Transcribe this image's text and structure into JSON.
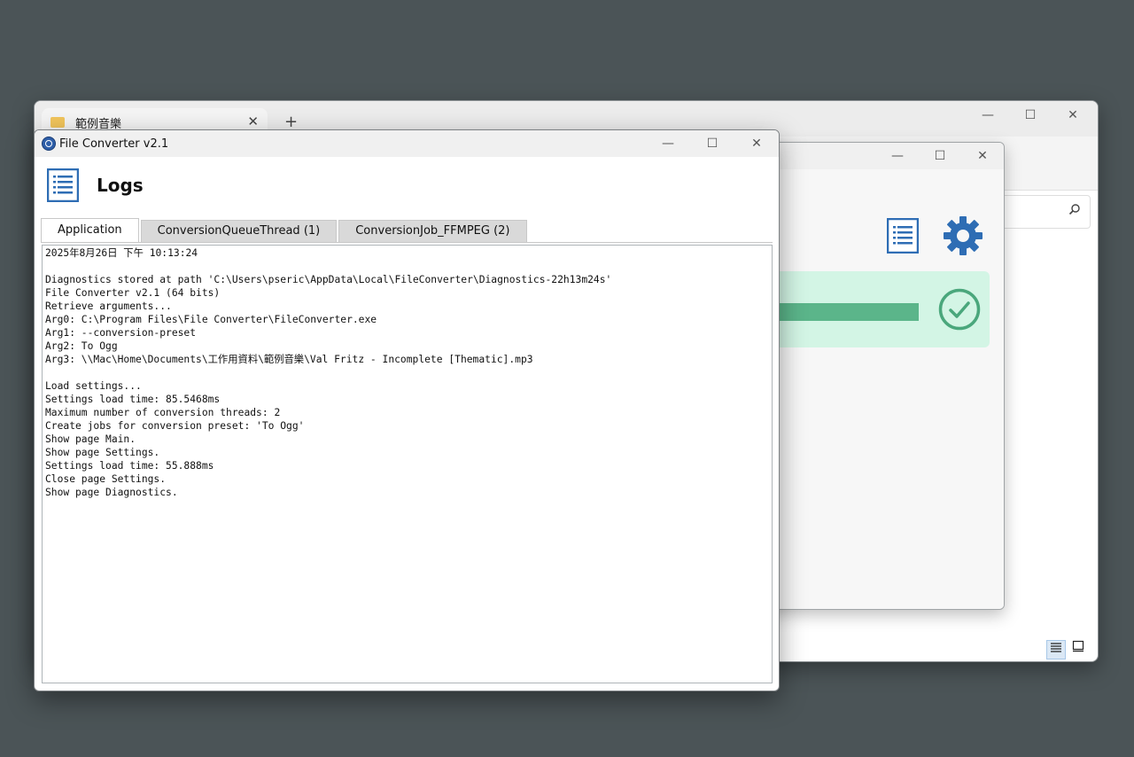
{
  "explorer": {
    "tab_title": "範例音樂",
    "tab_close": "✕",
    "new_tab": "+",
    "controls": {
      "minimize": "—",
      "maximize": "☐",
      "close": "✕"
    },
    "search_icon": "search-icon"
  },
  "fc_main": {
    "controls": {
      "minimize": "—",
      "maximize": "☐",
      "close": "✕"
    },
    "progress_percent": 100,
    "status": "done",
    "colors": {
      "card": "#d3f5e5",
      "progress": "#5bb58a",
      "accent": "#2e6db4"
    }
  },
  "logs_window": {
    "title": "File Converter v2.1",
    "controls": {
      "minimize": "—",
      "maximize": "☐",
      "close": "✕"
    },
    "heading": "Logs",
    "tabs": [
      {
        "label": "Application",
        "active": true
      },
      {
        "label": "ConversionQueueThread (1)",
        "active": false
      },
      {
        "label": "ConversionJob_FFMPEG (2)",
        "active": false
      }
    ],
    "log_lines": [
      "2025年8月26日 下午 10:13:24",
      "",
      "Diagnostics stored at path 'C:\\Users\\pseric\\AppData\\Local\\FileConverter\\Diagnostics-22h13m24s'",
      "File Converter v2.1 (64 bits)",
      "Retrieve arguments...",
      "Arg0: C:\\Program Files\\File Converter\\FileConverter.exe",
      "Arg1: --conversion-preset",
      "Arg2: To Ogg",
      "Arg3: \\\\Mac\\Home\\Documents\\工作用資料\\範例音樂\\Val Fritz - Incomplete [Thematic].mp3",
      "",
      "Load settings...",
      "Settings load time: 85.5468ms",
      "Maximum number of conversion threads: 2",
      "Create jobs for conversion preset: 'To Ogg'",
      "Show page Main.",
      "Show page Settings.",
      "Settings load time: 55.888ms",
      "Close page Settings.",
      "Show page Diagnostics."
    ]
  }
}
